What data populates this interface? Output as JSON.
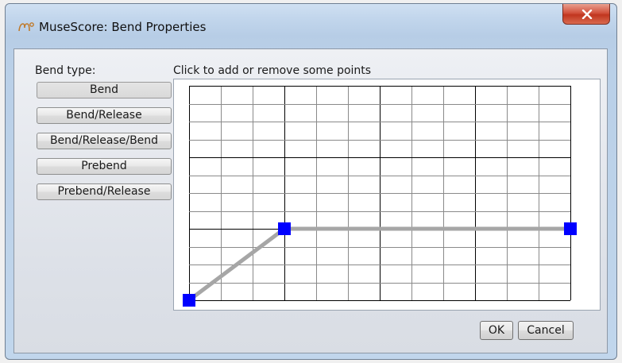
{
  "window": {
    "title": "MuseScore: Bend Properties"
  },
  "bend_type": {
    "label": "Bend type:",
    "options": [
      {
        "label": "Bend",
        "selected": true
      },
      {
        "label": "Bend/Release",
        "selected": false
      },
      {
        "label": "Bend/Release/Bend",
        "selected": false
      },
      {
        "label": "Prebend",
        "selected": false
      },
      {
        "label": "Prebend/Release",
        "selected": false
      }
    ]
  },
  "grid": {
    "hint": "Click to add or remove some points",
    "columns": 12,
    "rows": 12,
    "major_column_every": 3,
    "major_row_every": 4,
    "points": [
      {
        "col": 0,
        "row": 0
      },
      {
        "col": 3,
        "row": 4
      },
      {
        "col": 12,
        "row": 4
      }
    ],
    "point_color": "#0000ff",
    "line_color": "#a6a6a6"
  },
  "buttons": {
    "ok": "OK",
    "cancel": "Cancel"
  }
}
